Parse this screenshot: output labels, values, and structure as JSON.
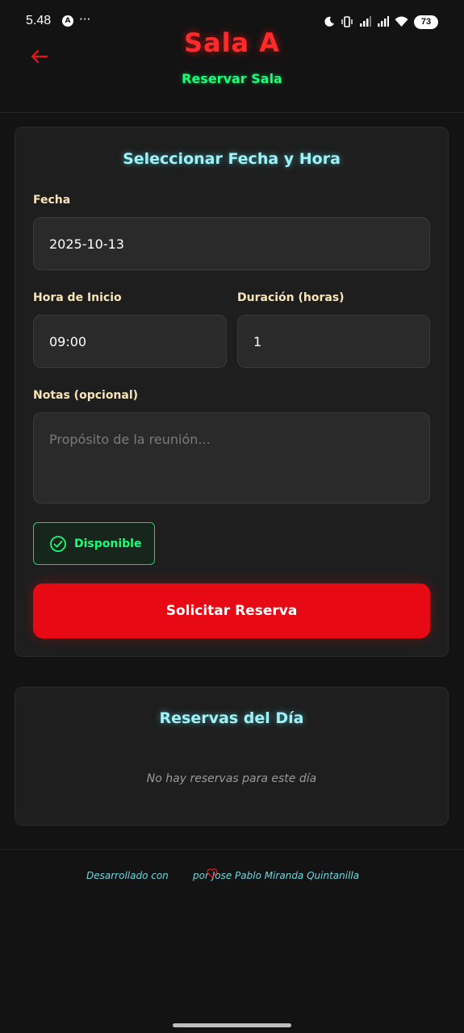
{
  "status_bar": {
    "time": "5.48",
    "more": "···",
    "battery": "73",
    "icons": [
      "moon-icon",
      "vibrate-icon",
      "signal-icon",
      "signal-icon",
      "wifi-icon",
      "battery-icon"
    ]
  },
  "header": {
    "back_icon": "arrow-left-icon",
    "title": "Sala A",
    "subtitle": "Reservar Sala"
  },
  "form": {
    "title": "Seleccionar Fecha y Hora",
    "date_label": "Fecha",
    "date_value": "2025-10-13",
    "start_label": "Hora de Inicio",
    "start_value": "09:00",
    "duration_label": "Duración (horas)",
    "duration_value": "1",
    "notes_label": "Notas (opcional)",
    "notes_placeholder": "Propósito de la reunión...",
    "availability": "Disponible",
    "submit_label": "Solicitar Reserva"
  },
  "day_reservations": {
    "title": "Reservas del Día",
    "empty_message": "No hay reservas para este día"
  },
  "footer": {
    "prefix": "Desarrollado con",
    "suffix": "por Jose Pablo Miranda Quintanilla"
  },
  "colors": {
    "accent_red": "#e70913",
    "accent_green": "#1aff7a",
    "accent_cyan": "#9ff3f8",
    "label_cream": "#fae5b8"
  }
}
